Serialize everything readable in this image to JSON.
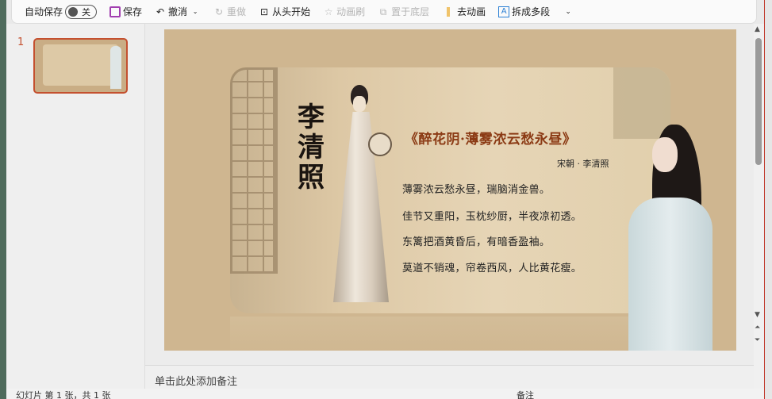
{
  "toolbar": {
    "autosave_label": "自动保存",
    "autosave_state": "关",
    "save": "保存",
    "undo": "撤消",
    "redo": "重做",
    "play_from_start": "从头开始",
    "format_painter": "动画刷",
    "send_to_back": "置于底层",
    "remove_animation": "去动画",
    "split_paragraphs": "拆成多段"
  },
  "thumbnails": [
    {
      "number": "1"
    }
  ],
  "slide": {
    "vertical_title": "李清照",
    "poem_title": "《醉花阴·薄雾浓云愁永昼》",
    "author": "宋朝 · 李清照",
    "lines": [
      "薄雾浓云愁永昼，瑞脑消金兽。",
      "佳节又重阳，玉枕纱厨，半夜凉初透。",
      "东篱把酒黄昏后，有暗香盈袖。",
      "莫道不销魂，帘卷西风，人比黄花瘦。"
    ]
  },
  "notes": {
    "placeholder": "单击此处添加备注"
  },
  "status": {
    "slide_info": "幻灯片 第 1 张，共 1 张",
    "notes_btn": "备注"
  }
}
